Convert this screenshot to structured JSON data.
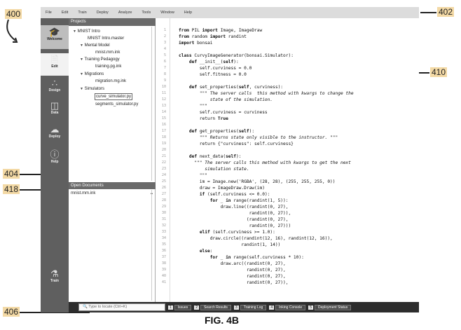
{
  "callouts": {
    "c400": "400",
    "c402": "402",
    "c410": "410",
    "c404": "404",
    "c418": "418",
    "c406": "406"
  },
  "menubar": [
    "File",
    "Edit",
    "Train",
    "Deploy",
    "Analyze",
    "Tools",
    "Window",
    "Help"
  ],
  "activitybar": {
    "welcome": {
      "label": "Welcome",
      "icon": "graduation-cap-icon"
    },
    "edit": {
      "label": "Edit",
      "icon": "document-icon"
    },
    "design": {
      "label": "Design",
      "icon": "nodes-icon"
    },
    "data": {
      "label": "Data",
      "icon": "database-icon"
    },
    "deploy": {
      "label": "Deploy",
      "icon": "cloud-upload-icon"
    },
    "help": {
      "label": "Help",
      "icon": "question-icon"
    },
    "train": {
      "label": "Train",
      "icon": "flask-icon"
    }
  },
  "sidebar": {
    "projects_title": "Projects",
    "tree": {
      "mnist_intro": "MNIST Intro",
      "mnist_master": "MNIST Intro.master",
      "mental_model": "Mental Model",
      "mnist_ink": "mnist.mm.ink",
      "training_pedagogy": "Training Pedagogy",
      "training_ink": "training.pg.ink",
      "migrations": "Migrations",
      "migration_ink": "migration.mg.ink",
      "simulators": "Simulators",
      "curve_sim": "curve_simulator.py",
      "segments_sim": "segments_simulator.py"
    },
    "open_docs_title": "Open Documents",
    "open_doc": "mnist.mm.ink"
  },
  "editor": {
    "line_numbers": [
      "1",
      "2",
      "3",
      "4",
      "5",
      "6",
      "7",
      "8",
      "9",
      "10",
      "11",
      "12",
      "13",
      "14",
      "15",
      "16",
      "17",
      "18",
      "19",
      "20",
      "21",
      "22",
      "23",
      "24",
      "25",
      "26",
      "27",
      "28",
      "29",
      "30",
      "31",
      "32",
      "33",
      "34",
      "35",
      "36",
      "37",
      "38",
      "39",
      "40",
      "41"
    ]
  },
  "statusbar": {
    "locate_placeholder": "Type to locate (Ctrl+K)",
    "tabs": [
      {
        "num": "1",
        "label": "Issues"
      },
      {
        "num": "2",
        "label": "Search Results"
      },
      {
        "num": "3",
        "label": "Training Log"
      },
      {
        "num": "4",
        "label": "Inking Console"
      },
      {
        "num": "5",
        "label": "Deployment Status"
      }
    ]
  },
  "caption": "FIG. 4B"
}
